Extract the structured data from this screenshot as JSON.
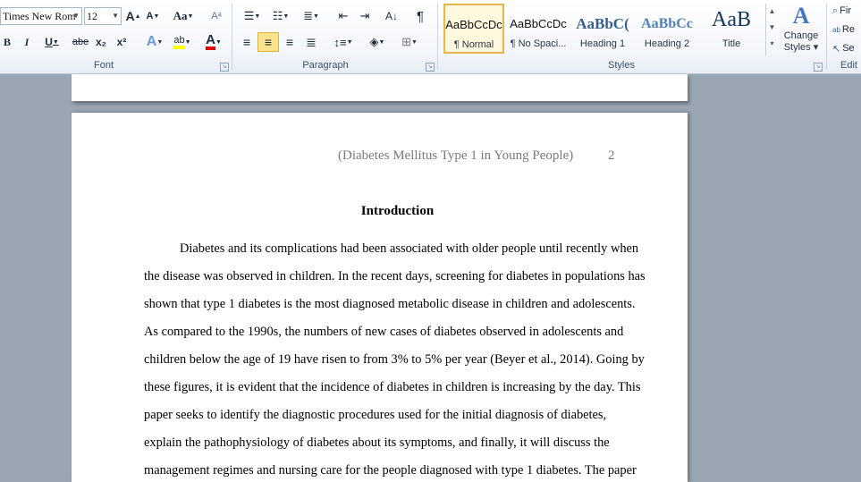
{
  "ribbon": {
    "font": {
      "family_value": "Times New Rom",
      "size_value": "12",
      "grow_label": "A",
      "shrink_label": "A",
      "case_label": "Aa",
      "bold_label": "B",
      "italic_label": "I",
      "underline_label": "U",
      "strike_label": "abe",
      "subscript_label": "x₂",
      "superscript_label": "x²",
      "effects_label": "A",
      "highlight_label": "ab",
      "color_label": "A",
      "group_label": "Font"
    },
    "paragraph": {
      "pilcrow_label": "¶",
      "group_label": "Paragraph"
    },
    "styles": {
      "items": [
        {
          "sample": "AaBbCcDc",
          "name": "¶ Normal"
        },
        {
          "sample": "AaBbCcDc",
          "name": "¶ No Spaci..."
        },
        {
          "sample": "AaBbC(",
          "name": "Heading 1"
        },
        {
          "sample": "AaBbCc",
          "name": "Heading 2"
        },
        {
          "sample": "AaB",
          "name": "Title"
        }
      ],
      "change_styles_line1": "Change",
      "change_styles_line2": "Styles ▾",
      "group_label": "Styles"
    },
    "editing": {
      "find_label": "Fir",
      "replace_label": "Re",
      "select_label": "Se",
      "group_label": "Edit"
    },
    "accent_color": "#e6b64a"
  },
  "document": {
    "header_text": "(Diabetes Mellitus Type 1 in Young People)",
    "page_number": "2",
    "heading": "Introduction",
    "lines": [
      "Diabetes and its complications had been associated with older people until recently when",
      "the disease was observed in children. In the recent days, screening for diabetes in populations has",
      "shown that type 1 diabetes is the most diagnosed metabolic disease in children and adolescents.",
      "As compared to the 1990s, the numbers of new cases of diabetes observed in adolescents and",
      "children below the age of 19 have risen to from 3% to 5% per year (Beyer et al., 2014). Going by",
      "these figures, it is evident that the incidence of diabetes in children is increasing by the day. This",
      "paper seeks to identify the diagnostic procedures used for the initial diagnosis of diabetes,",
      "explain the pathophysiology of diabetes about its symptoms, and finally, it will discuss the",
      "management regimes and nursing care for the people diagnosed with type 1 diabetes. The paper"
    ]
  }
}
